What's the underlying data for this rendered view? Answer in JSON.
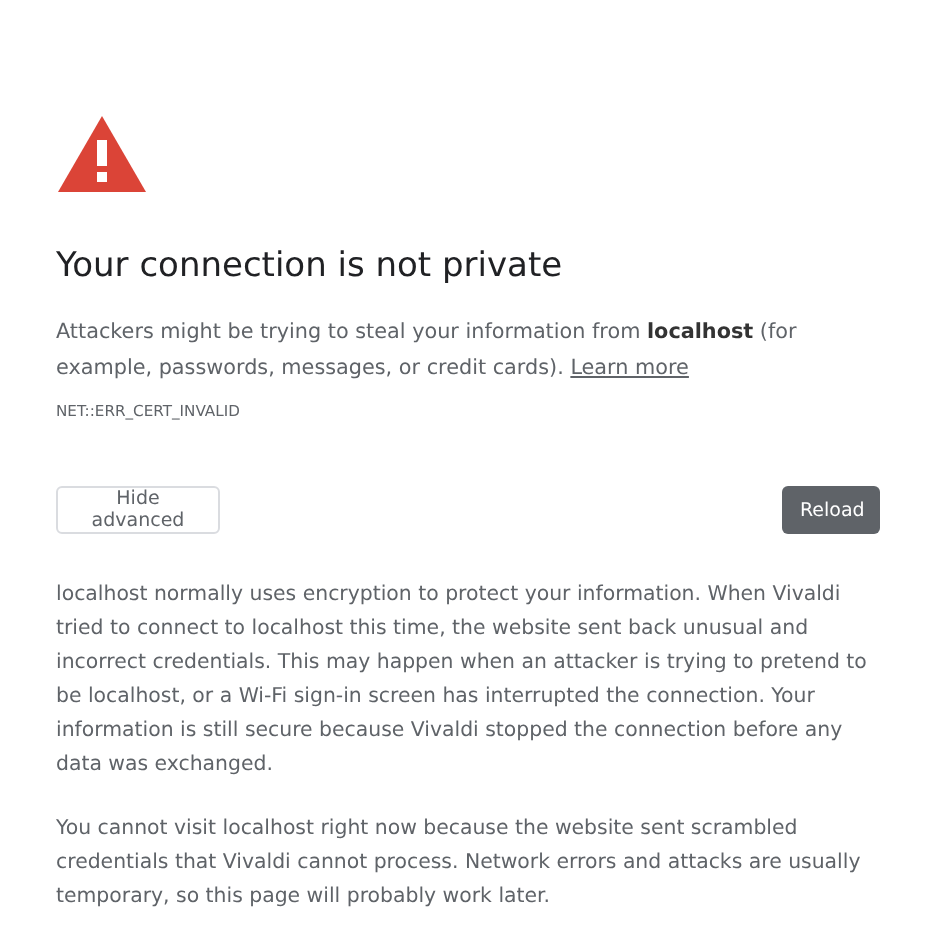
{
  "heading": "Your connection is not private",
  "summary": {
    "text": "Attackers might be trying to steal your information from **localhost** (for example, passwords, messages, or credit cards).",
    "link": "Learn more"
  },
  "error_code": "NET::ERR_CERT_INVALID",
  "buttons": [
    {
      "label": "Hide advanced",
      "kind": "secondary"
    },
    {
      "label": "Reload",
      "kind": "primary"
    }
  ],
  "details": [
    "localhost normally uses encryption to protect your information. When Vivaldi tried to connect to localhost this time, the website sent back unusual and incorrect credentials. This may happen when an attacker is trying to pretend to be localhost, or a Wi-Fi sign-in screen has interrupted the connection. Your information is still secure because Vivaldi stopped the connection before any data was exchanged.",
    "You cannot visit localhost right now because the website sent scrambled credentials that Vivaldi cannot process. Network errors and attacks are usually temporary, so this page will probably work later."
  ]
}
